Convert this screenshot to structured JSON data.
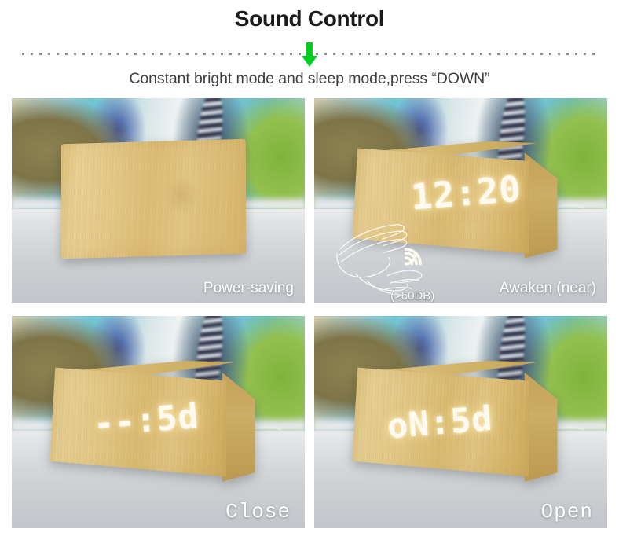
{
  "header": {
    "title": "Sound Control",
    "subtitle": "Constant bright mode and sleep mode,press “DOWN”",
    "arrow_icon": "arrow-down-icon",
    "arrow_color": "#00cc22",
    "divider": "dotted-divider"
  },
  "panels": [
    {
      "id": "power-saving",
      "caption": "Power-saving",
      "caption_style": "sans",
      "display": "",
      "display_on": false,
      "clock_shape": "flat-front"
    },
    {
      "id": "awaken-near",
      "caption": "Awaken (near)",
      "caption_style": "sans",
      "display": "12:20",
      "display_on": true,
      "clock_shape": "wedge",
      "hand_icon": "hand-clap-icon",
      "wave_icon": "sound-wave-icon",
      "db_label": "(>60DB)"
    },
    {
      "id": "close",
      "caption": "Close",
      "caption_style": "serif",
      "display": "--:5d",
      "display_on": true,
      "clock_shape": "wedge"
    },
    {
      "id": "open",
      "caption": "Open",
      "caption_style": "serif",
      "display": "oN:5d",
      "display_on": true,
      "clock_shape": "wedge"
    }
  ],
  "colors": {
    "title": "#1b1b1b",
    "subtitle": "#3e3e3e",
    "arrow_green": "#00cc22",
    "led_white": "#fffaf0",
    "wood": "#e0c482",
    "background": "#ffffff"
  }
}
